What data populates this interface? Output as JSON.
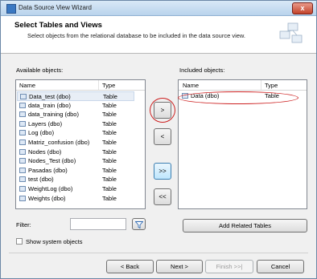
{
  "window": {
    "title": "Data Source View Wizard",
    "close_glyph": "x"
  },
  "header": {
    "title": "Select Tables and Views",
    "description": "Select objects from the relational database to be included in the data source view."
  },
  "available": {
    "label": "Available objects:",
    "col_name": "Name",
    "col_type": "Type",
    "rows": [
      {
        "name": "Data_test (dbo)",
        "type": "Table"
      },
      {
        "name": "data_train (dbo)",
        "type": "Table"
      },
      {
        "name": "data_training (dbo)",
        "type": "Table"
      },
      {
        "name": "Layers (dbo)",
        "type": "Table"
      },
      {
        "name": "Log (dbo)",
        "type": "Table"
      },
      {
        "name": "Matriz_confusion (dbo)",
        "type": "Table"
      },
      {
        "name": "Nodes (dbo)",
        "type": "Table"
      },
      {
        "name": "Nodes_Test (dbo)",
        "type": "Table"
      },
      {
        "name": "Pasadas (dbo)",
        "type": "Table"
      },
      {
        "name": "test (dbo)",
        "type": "Table"
      },
      {
        "name": "WeightLog (dbo)",
        "type": "Table"
      },
      {
        "name": "Weights (dbo)",
        "type": "Table"
      }
    ]
  },
  "included": {
    "label": "Included objects:",
    "col_name": "Name",
    "col_type": "Type",
    "rows": [
      {
        "name": "Data (dbo)",
        "type": "Table"
      }
    ]
  },
  "transfer": {
    "add": ">",
    "remove": "<",
    "add_all": ">>",
    "remove_all": "<<"
  },
  "filter": {
    "label": "Filter:",
    "value": "",
    "icon": "funnel-icon"
  },
  "add_related": "Add Related Tables",
  "show_system": "Show system objects",
  "nav": {
    "back": "< Back",
    "next": "Next >",
    "finish": "Finish >>|",
    "cancel": "Cancel"
  },
  "colors": {
    "annotation": "#cc1f1f",
    "accent": "#3c7fb1"
  }
}
